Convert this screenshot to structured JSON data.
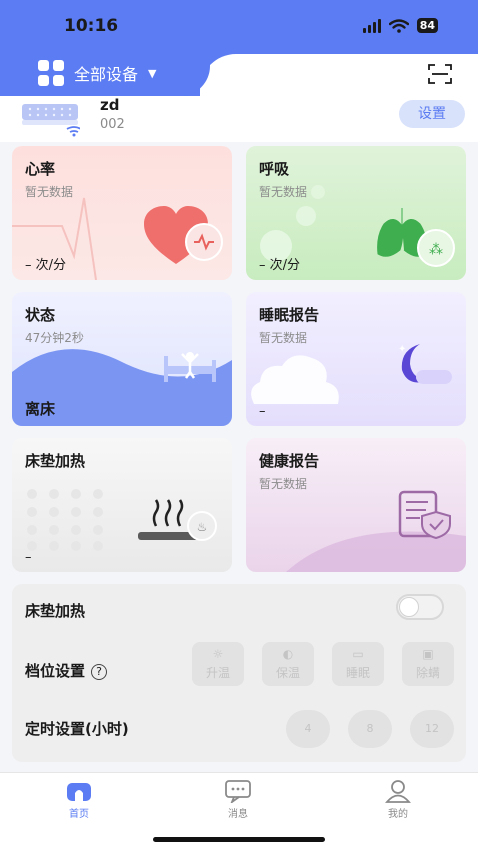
{
  "status_bar": {
    "time": "10:16",
    "battery": "84"
  },
  "header": {
    "device_filter_label": "全部设备"
  },
  "device": {
    "name": "zd",
    "id": "002",
    "settings_label": "设置"
  },
  "cards": {
    "heart": {
      "title": "心率",
      "sub": "暂无数据",
      "foot": "– 次/分"
    },
    "breath": {
      "title": "呼吸",
      "sub": "暂无数据",
      "foot": "– 次/分"
    },
    "state": {
      "title": "状态",
      "sub": "47分钟2秒",
      "foot": "离床"
    },
    "sleep": {
      "title": "睡眠报告",
      "sub": "暂无数据",
      "foot": "–"
    },
    "heat": {
      "title": "床垫加热",
      "foot": "–"
    },
    "health": {
      "title": "健康报告",
      "sub": "暂无数据"
    }
  },
  "control": {
    "heating_label": "床垫加热",
    "gear_label": "档位设置",
    "help_glyph": "?",
    "modes": [
      "升温",
      "保温",
      "睡眠",
      "除螨"
    ],
    "timer_label": "定时设置(小时)",
    "timers": [
      "4",
      "8",
      "12"
    ]
  },
  "tabs": [
    {
      "label": "首页",
      "icon": "home-icon"
    },
    {
      "label": "消息",
      "icon": "message-icon"
    },
    {
      "label": "我的",
      "icon": "profile-icon"
    }
  ],
  "colors": {
    "accent": "#5b7cf2"
  }
}
